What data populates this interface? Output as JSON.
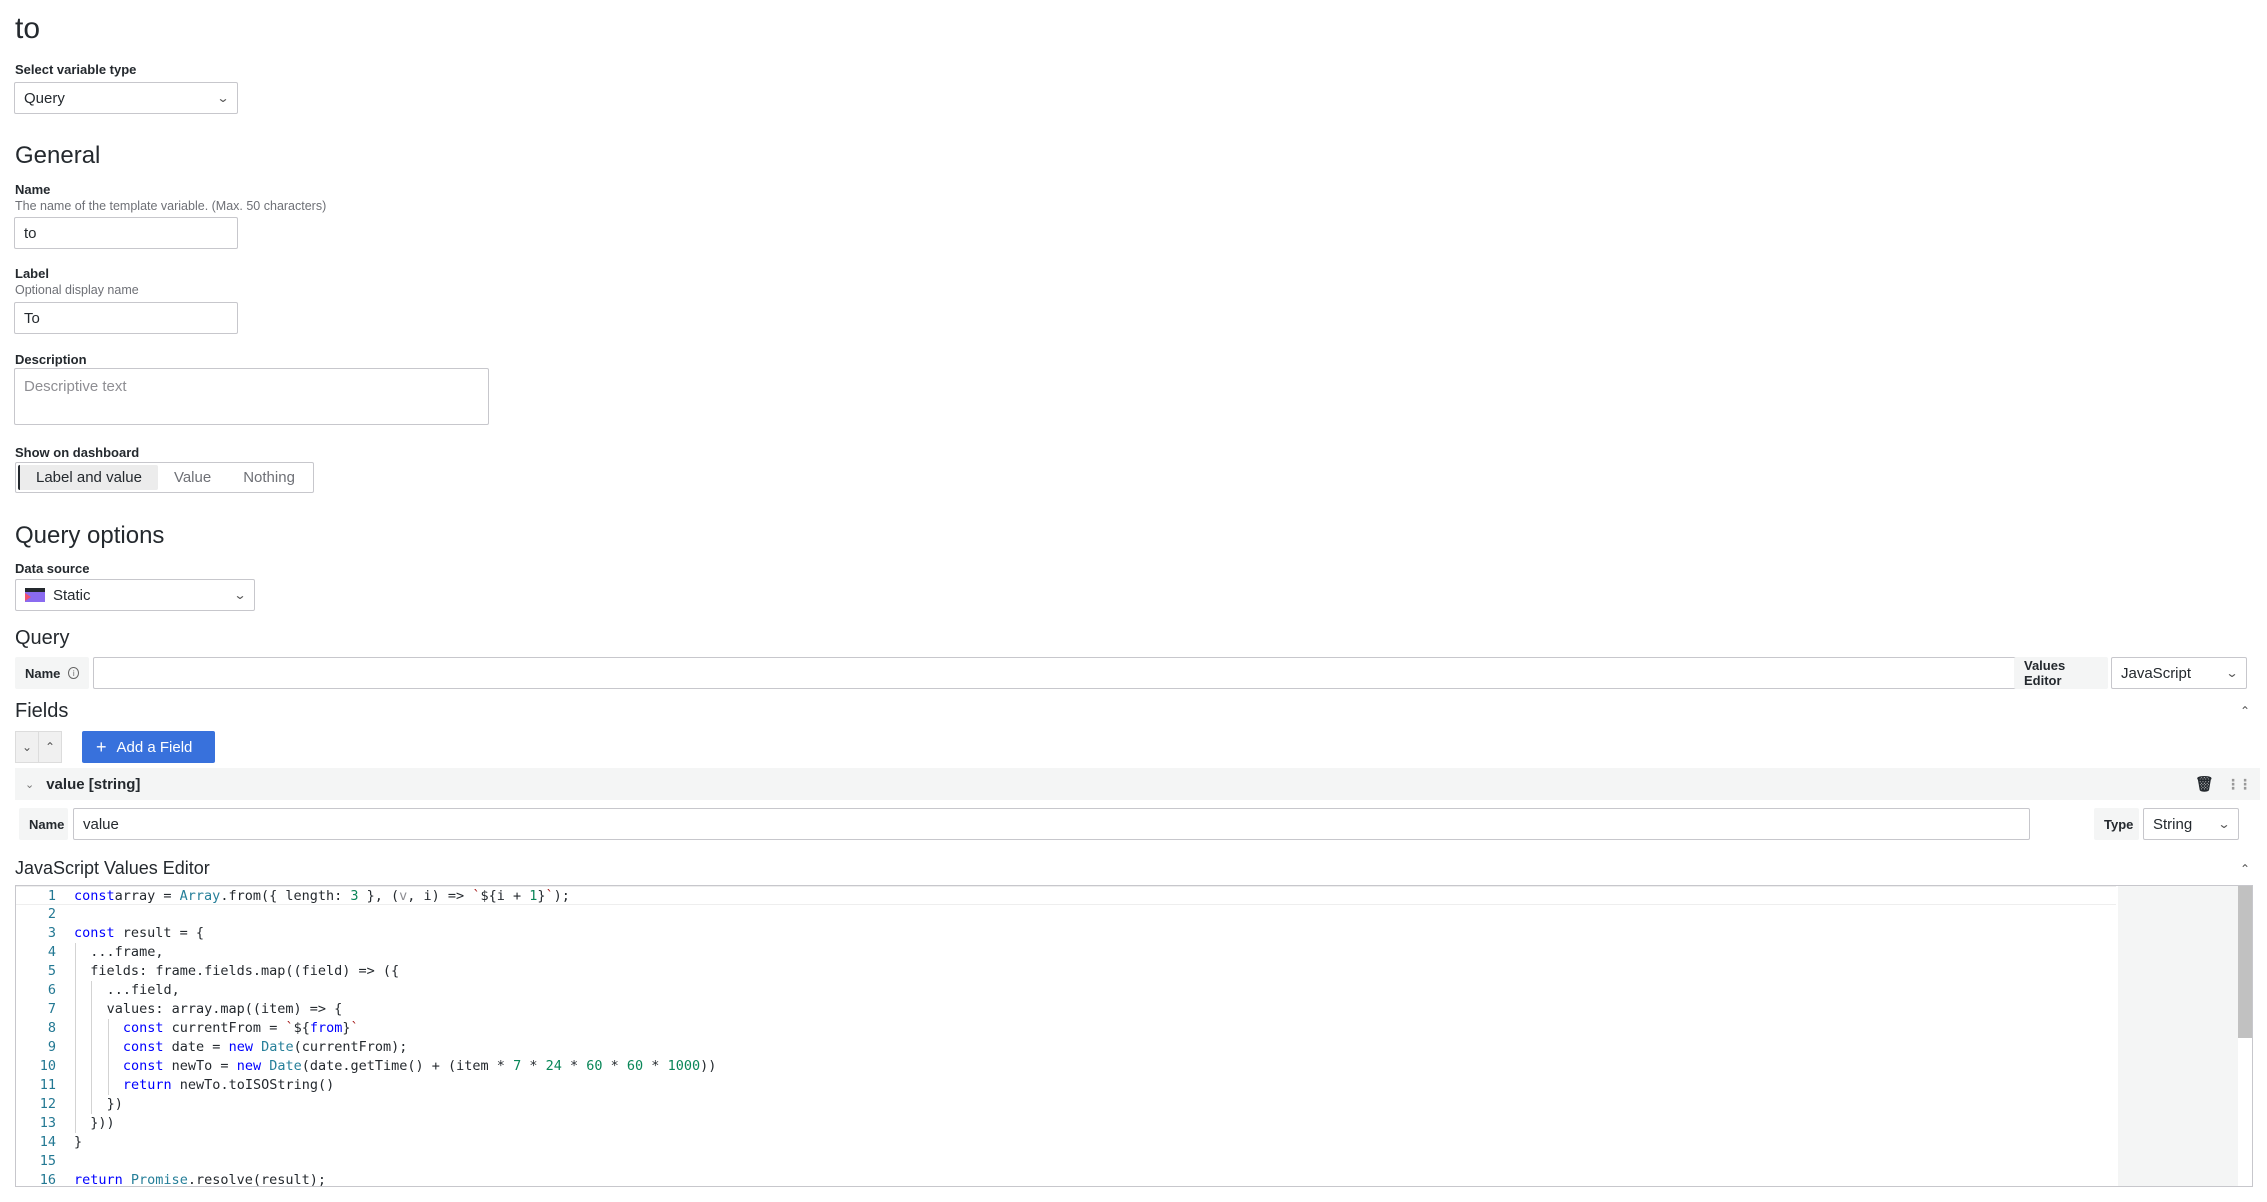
{
  "page": {
    "title": "to"
  },
  "variable_type": {
    "label": "Select variable type",
    "value": "Query"
  },
  "general": {
    "heading": "General",
    "name": {
      "label": "Name",
      "description": "The name of the template variable. (Max. 50 characters)",
      "value": "to"
    },
    "label_field": {
      "label": "Label",
      "description": "Optional display name",
      "value": "To"
    },
    "description": {
      "label": "Description",
      "placeholder": "Descriptive text",
      "value": ""
    },
    "show_on_dashboard": {
      "label": "Show on dashboard",
      "options": [
        "Label and value",
        "Value",
        "Nothing"
      ],
      "selected": "Label and value"
    }
  },
  "query_options": {
    "heading": "Query options",
    "data_source": {
      "label": "Data source",
      "value": "Static",
      "icon": "static-datasource-icon"
    }
  },
  "query": {
    "heading": "Query",
    "name_label": "Name",
    "name_info_icon": "info-circle-icon",
    "name_value": "",
    "values_editor_label": "Values Editor",
    "values_editor_value": "JavaScript"
  },
  "fields": {
    "heading": "Fields",
    "collapse_all_icon": "chevrons-down-icon",
    "expand_all_icon": "chevrons-up-icon",
    "add_button": "Add a Field",
    "add_icon": "plus-icon",
    "items": [
      {
        "header": "value [string]",
        "name_label": "Name",
        "name_value": "value",
        "type_label": "Type",
        "type_value": "String",
        "delete_icon": "trash-icon",
        "drag_icon": "drag-handle-icon"
      }
    ]
  },
  "js_editor": {
    "heading": "JavaScript Values Editor",
    "lines": [
      {
        "n": "1",
        "indent": 0,
        "tokens": [
          [
            "kw",
            "const"
          ],
          [
            "",
            "array = "
          ],
          [
            "ty",
            "Array"
          ],
          [
            "",
            ".from({ length: "
          ],
          [
            "num",
            "3"
          ],
          [
            "",
            " }, ("
          ],
          [
            "muted",
            "v"
          ],
          [
            "",
            ", i) => "
          ],
          [
            "str",
            "`"
          ],
          [
            "",
            "${i + "
          ],
          [
            "num",
            "1"
          ],
          [
            "",
            "}"
          ],
          [
            "str",
            "`"
          ],
          [
            "",
            ");"
          ]
        ]
      },
      {
        "n": "2",
        "indent": 0,
        "tokens": []
      },
      {
        "n": "3",
        "indent": 0,
        "tokens": [
          [
            "kw",
            "const"
          ],
          [
            "",
            " result = {"
          ]
        ]
      },
      {
        "n": "4",
        "indent": 1,
        "tokens": [
          [
            "",
            "...frame,"
          ]
        ]
      },
      {
        "n": "5",
        "indent": 1,
        "tokens": [
          [
            "",
            "fields: frame.fields.map((field) => ({"
          ]
        ]
      },
      {
        "n": "6",
        "indent": 2,
        "tokens": [
          [
            "",
            "...field,"
          ]
        ]
      },
      {
        "n": "7",
        "indent": 2,
        "tokens": [
          [
            "",
            "values: array.map((item) => {"
          ]
        ]
      },
      {
        "n": "8",
        "indent": 3,
        "tokens": [
          [
            "kw",
            "const"
          ],
          [
            "",
            " currentFrom = "
          ],
          [
            "str",
            "`"
          ],
          [
            "",
            "${"
          ],
          [
            "kw",
            "from"
          ],
          [
            "",
            "}"
          ],
          [
            "str",
            "`"
          ]
        ]
      },
      {
        "n": "9",
        "indent": 3,
        "tokens": [
          [
            "kw",
            "const"
          ],
          [
            "",
            " date = "
          ],
          [
            "kw",
            "new"
          ],
          [
            "",
            " "
          ],
          [
            "ty",
            "Date"
          ],
          [
            "",
            "(currentFrom);"
          ]
        ]
      },
      {
        "n": "10",
        "indent": 3,
        "tokens": [
          [
            "kw",
            "const"
          ],
          [
            "",
            " newTo = "
          ],
          [
            "kw",
            "new"
          ],
          [
            "",
            " "
          ],
          [
            "ty",
            "Date"
          ],
          [
            "",
            "(date.getTime() + (item * "
          ],
          [
            "num",
            "7"
          ],
          [
            "",
            " * "
          ],
          [
            "num",
            "24"
          ],
          [
            "",
            " * "
          ],
          [
            "num",
            "60"
          ],
          [
            "",
            " * "
          ],
          [
            "num",
            "60"
          ],
          [
            "",
            " * "
          ],
          [
            "num",
            "1000"
          ],
          [
            "",
            "))"
          ]
        ]
      },
      {
        "n": "11",
        "indent": 3,
        "tokens": [
          [
            "kw",
            "return"
          ],
          [
            "",
            " newTo.toISOString()"
          ]
        ]
      },
      {
        "n": "12",
        "indent": 2,
        "tokens": [
          [
            "",
            "})"
          ]
        ]
      },
      {
        "n": "13",
        "indent": 1,
        "tokens": [
          [
            "",
            "}))"
          ]
        ]
      },
      {
        "n": "14",
        "indent": 0,
        "tokens": [
          [
            "",
            "}"
          ]
        ]
      },
      {
        "n": "15",
        "indent": 0,
        "tokens": []
      },
      {
        "n": "16",
        "indent": 0,
        "tokens": [
          [
            "kw",
            "return"
          ],
          [
            "",
            " "
          ],
          [
            "ty",
            "Promise"
          ],
          [
            "",
            ".resolve(result);"
          ]
        ]
      }
    ],
    "collapse_icon": "chevron-up-icon"
  }
}
